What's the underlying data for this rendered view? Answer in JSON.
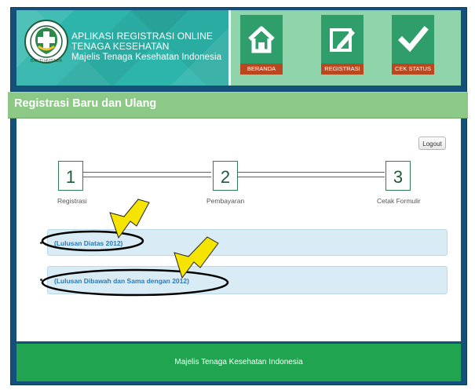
{
  "header": {
    "app_line1": "APLIKASI REGISTRASI ONLINE",
    "app_line2": "TENAGA KESEHATAN",
    "app_line3": "Majelis Tenaga Kesehatan Indonesia",
    "logo_text": "BAKTI HUSADA"
  },
  "nav": {
    "items": [
      {
        "label": "BERANDA",
        "icon": "home-icon"
      },
      {
        "label": "REGISTRASI",
        "icon": "edit-icon"
      },
      {
        "label": "CEK STATUS",
        "icon": "checkmark-icon"
      }
    ]
  },
  "page": {
    "title": "Registrasi Baru dan Ulang",
    "logout_label": "Logout"
  },
  "steps": [
    {
      "number": "1",
      "label": "Registrasi"
    },
    {
      "number": "2",
      "label": "Pembayaran"
    },
    {
      "number": "3",
      "label": "Cetak Formulir"
    }
  ],
  "options": [
    {
      "label": "(Lulusan Diatas 2012)"
    },
    {
      "label": "(Lulusan Dibawah dan Sama dengan 2012)"
    }
  ],
  "footer": {
    "text": "Majelis Tenaga Kesehatan Indonesia"
  },
  "colors": {
    "frame": "#13507a",
    "banner": "#2db5ab",
    "nav_bg": "#8fd4aa",
    "nav_tile": "#2f9e6a",
    "nav_label": "#b9471f",
    "title_bar": "#8cc886",
    "option_bg": "#d9ecf5",
    "link": "#2b79b5",
    "footer": "#20a44f",
    "annotation_arrow": "#f4e400"
  }
}
